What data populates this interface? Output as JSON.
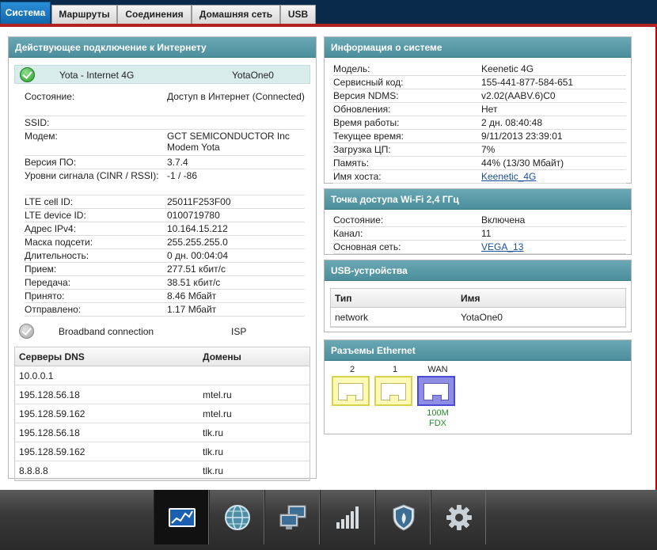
{
  "tabs": [
    "Система",
    "Маршруты",
    "Соединения",
    "Домашняя сеть",
    "USB"
  ],
  "active_tab": "Система",
  "internet": {
    "title": "Действующее подключение к Интернету",
    "active": {
      "name": "Yota - Internet 4G",
      "iface": "YotaOne0"
    },
    "rows": [
      {
        "k": "Состояние:",
        "v": "Доступ в Интернет (Connected)"
      },
      {
        "k": "SSID:",
        "v": ""
      },
      {
        "k": "Модем:",
        "v": "GCT SEMICONDUCTOR Inc Modem Yota"
      },
      {
        "k": "Версия ПО:",
        "v": "3.7.4"
      },
      {
        "k": "Уровни сигнала (CINR / RSSI):",
        "v": "-1 / -86"
      },
      {
        "k": "LTE cell ID:",
        "v": "25011F253F00"
      },
      {
        "k": "LTE device ID:",
        "v": "0100719780"
      },
      {
        "k": "Адрес IPv4:",
        "v": "10.164.15.212"
      },
      {
        "k": "Маска подсети:",
        "v": "255.255.255.0"
      },
      {
        "k": "Длительность:",
        "v": "0 дн. 00:04:04"
      },
      {
        "k": "Прием:",
        "v": "277.51 кбит/с"
      },
      {
        "k": "Передача:",
        "v": "38.51 кбит/с"
      },
      {
        "k": "Принято:",
        "v": "8.46 Мбайт"
      },
      {
        "k": "Отправлено:",
        "v": "1.17 Мбайт"
      }
    ],
    "backup": {
      "name": "Broadband connection",
      "iface": "ISP"
    }
  },
  "dns": {
    "col_servers": "Серверы DNS",
    "col_domains": "Домены",
    "rows": [
      {
        "server": "10.0.0.1",
        "domain": ""
      },
      {
        "server": "195.128.56.18",
        "domain": "mtel.ru"
      },
      {
        "server": "195.128.59.162",
        "domain": "mtel.ru"
      },
      {
        "server": "195.128.56.18",
        "domain": "tlk.ru"
      },
      {
        "server": "195.128.59.162",
        "domain": "tlk.ru"
      },
      {
        "server": "8.8.8.8",
        "domain": "tlk.ru"
      }
    ]
  },
  "sysinfo": {
    "title": "Информация о системе",
    "rows": [
      {
        "k": "Модель:",
        "v": "Keenetic 4G"
      },
      {
        "k": "Сервисный код:",
        "v": "155-441-877-584-651"
      },
      {
        "k": "Версия NDMS:",
        "v": "v2.02(AABV.6)C0"
      },
      {
        "k": "Обновления:",
        "v": "Нет"
      },
      {
        "k": "Время работы:",
        "v": "2 дн. 08:40:48"
      },
      {
        "k": "Текущее время:",
        "v": "9/11/2013 23:39:01"
      },
      {
        "k": "Загрузка ЦП:",
        "v": "7%"
      },
      {
        "k": "Память:",
        "v": "44% (13/30 Мбайт)"
      },
      {
        "k": "Имя хоста:",
        "v": "Keenetic_4G",
        "link": true
      }
    ]
  },
  "wifi": {
    "title": "Точка доступа Wi-Fi 2,4 ГГц",
    "rows": [
      {
        "k": "Состояние:",
        "v": "Включена"
      },
      {
        "k": "Канал:",
        "v": "11"
      },
      {
        "k": "Основная сеть:",
        "v": "VEGA_13",
        "link": true
      }
    ]
  },
  "usb": {
    "title": "USB-устройства",
    "col_type": "Тип",
    "col_name": "Имя",
    "rows": [
      {
        "type": "network",
        "name": "YotaOne0"
      }
    ]
  },
  "ethernet": {
    "title": "Разъемы Ethernet",
    "ports": [
      {
        "label": "2",
        "kind": "lan",
        "status": ""
      },
      {
        "label": "1",
        "kind": "lan",
        "status": ""
      },
      {
        "label": "WAN",
        "kind": "wan",
        "status": "100M FDX"
      }
    ]
  },
  "dock": [
    "monitor-chart-icon",
    "globe-icon",
    "network-computers-icon",
    "signal-bars-icon",
    "shield-icon",
    "gear-icon"
  ],
  "dock_active": 0
}
